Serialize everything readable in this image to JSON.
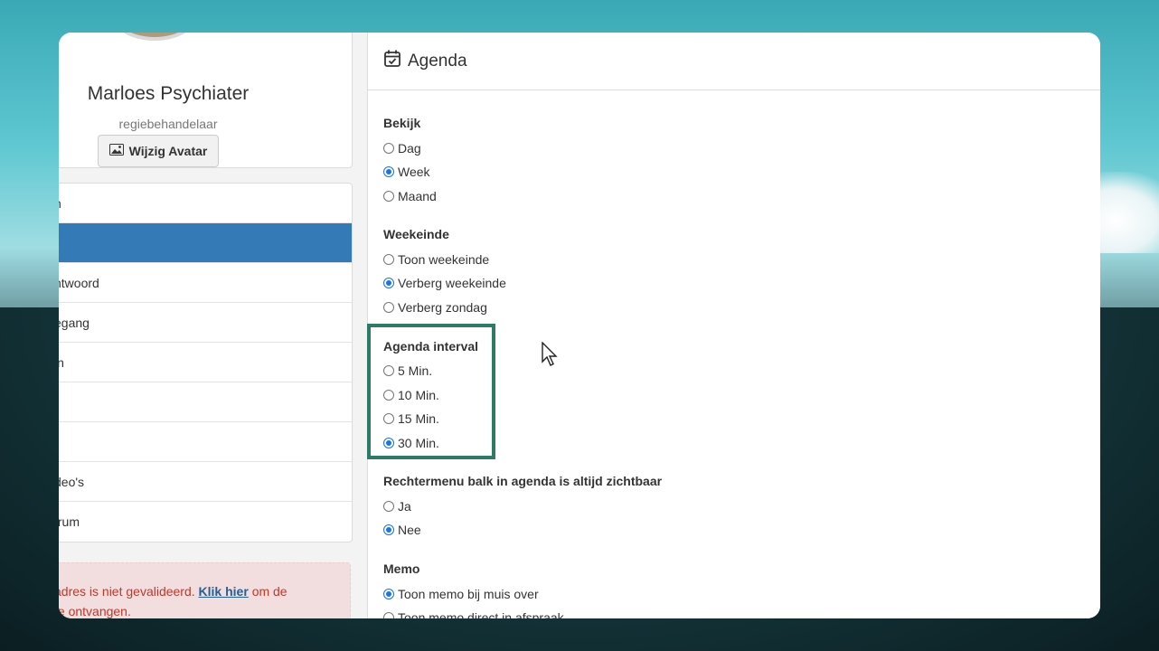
{
  "profile": {
    "name": "Marloes Psychiater",
    "role": "regiebehandelaar",
    "avatar_button": "Wijzig Avatar"
  },
  "menu": {
    "items": [
      {
        "label": "n",
        "active": false
      },
      {
        "label": "",
        "active": true
      },
      {
        "label": "ntwoord",
        "active": false
      },
      {
        "label": "egang",
        "active": false
      },
      {
        "label": "in",
        "active": false
      },
      {
        "label": "",
        "active": false
      },
      {
        "label": "",
        "active": false
      },
      {
        "label": "deo's",
        "active": false
      },
      {
        "label": "trum",
        "active": false
      }
    ]
  },
  "alert": {
    "text_before": "adres is niet gevalideerd.",
    "link": "Klik hier",
    "text_after": "om de",
    "line2": "te ontvangen."
  },
  "panel": {
    "title": "Agenda",
    "icon": "calendar-check-icon"
  },
  "settings": {
    "bekijk": {
      "label": "Bekijk",
      "options": [
        "Dag",
        "Week",
        "Maand"
      ],
      "selected": 1
    },
    "weekeinde": {
      "label": "Weekeinde",
      "options": [
        "Toon weekeinde",
        "Verberg weekeinde",
        "Verberg zondag"
      ],
      "selected": 1
    },
    "interval": {
      "label": "Agenda interval",
      "options": [
        "5 Min.",
        "10 Min.",
        "15 Min.",
        "30 Min."
      ],
      "selected": 3
    },
    "rechtermenu": {
      "label": "Rechtermenu balk in agenda is altijd zichtbaar",
      "options": [
        "Ja",
        "Nee"
      ],
      "selected": 1
    },
    "memo": {
      "label": "Memo",
      "options": [
        "Toon memo bij muis over",
        "Toon memo direct in afspraak"
      ],
      "selected": 0
    }
  },
  "colors": {
    "accent": "#337ab7",
    "radio": "#1a73e8",
    "highlight": "#2d7a66"
  }
}
